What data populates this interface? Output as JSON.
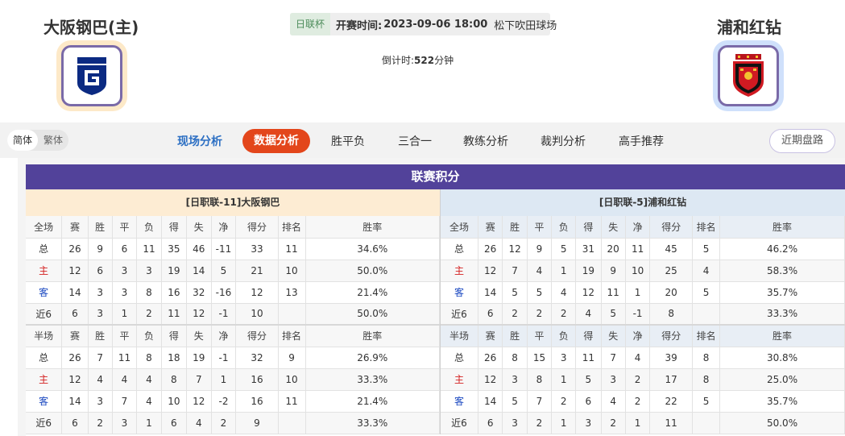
{
  "match": {
    "home_team": "大阪钢巴(主)",
    "away_team": "浦和红钻",
    "league_tag": "日联杯",
    "kickoff_label": "开赛时间:",
    "kickoff_time": "2023-09-06 18:00",
    "venue": "松下吹田球场",
    "countdown_label": "倒计时:",
    "countdown_value": "522",
    "countdown_unit": "分钟"
  },
  "lang": {
    "simplified": "简体",
    "traditional": "繁体"
  },
  "nav": {
    "tabs": [
      "现场分析",
      "数据分析",
      "胜平负",
      "三合一",
      "教练分析",
      "裁判分析",
      "高手推荐"
    ],
    "active_tab": "数据分析",
    "recent_button": "近期盘路"
  },
  "colors": {
    "accent": "#e3461b",
    "section": "#52429a",
    "link": "#2c6fc3",
    "home_row": "#d42020",
    "away_row": "#1a48c0"
  },
  "standings": {
    "title": "联赛积分",
    "home": {
      "label": "[日职联-11]大阪钢巴",
      "full_header": [
        "全场",
        "赛",
        "胜",
        "平",
        "负",
        "得",
        "失",
        "净",
        "得分",
        "排名",
        "胜率"
      ],
      "full_rows": [
        {
          "type": "总",
          "cells": [
            "26",
            "9",
            "6",
            "11",
            "35",
            "46",
            "-11",
            "33",
            "11",
            "34.6%"
          ]
        },
        {
          "type": "主",
          "cells": [
            "12",
            "6",
            "3",
            "3",
            "19",
            "14",
            "5",
            "21",
            "10",
            "50.0%"
          ]
        },
        {
          "type": "客",
          "cells": [
            "14",
            "3",
            "3",
            "8",
            "16",
            "32",
            "-16",
            "12",
            "13",
            "21.4%"
          ]
        },
        {
          "type": "近6",
          "cells": [
            "6",
            "3",
            "1",
            "2",
            "11",
            "12",
            "-1",
            "10",
            "",
            "50.0%"
          ]
        }
      ],
      "half_header": [
        "半场",
        "赛",
        "胜",
        "平",
        "负",
        "得",
        "失",
        "净",
        "得分",
        "排名",
        "胜率"
      ],
      "half_rows": [
        {
          "type": "总",
          "cells": [
            "26",
            "7",
            "11",
            "8",
            "18",
            "19",
            "-1",
            "32",
            "9",
            "26.9%"
          ]
        },
        {
          "type": "主",
          "cells": [
            "12",
            "4",
            "4",
            "4",
            "8",
            "7",
            "1",
            "16",
            "10",
            "33.3%"
          ]
        },
        {
          "type": "客",
          "cells": [
            "14",
            "3",
            "7",
            "4",
            "10",
            "12",
            "-2",
            "16",
            "11",
            "21.4%"
          ]
        },
        {
          "type": "近6",
          "cells": [
            "6",
            "2",
            "3",
            "1",
            "6",
            "4",
            "2",
            "9",
            "",
            "33.3%"
          ]
        }
      ]
    },
    "away": {
      "label": "[日职联-5]浦和红钻",
      "full_header": [
        "全场",
        "赛",
        "胜",
        "平",
        "负",
        "得",
        "失",
        "净",
        "得分",
        "排名",
        "胜率"
      ],
      "full_rows": [
        {
          "type": "总",
          "cells": [
            "26",
            "12",
            "9",
            "5",
            "31",
            "20",
            "11",
            "45",
            "5",
            "46.2%"
          ]
        },
        {
          "type": "主",
          "cells": [
            "12",
            "7",
            "4",
            "1",
            "19",
            "9",
            "10",
            "25",
            "4",
            "58.3%"
          ]
        },
        {
          "type": "客",
          "cells": [
            "14",
            "5",
            "5",
            "4",
            "12",
            "11",
            "1",
            "20",
            "5",
            "35.7%"
          ]
        },
        {
          "type": "近6",
          "cells": [
            "6",
            "2",
            "2",
            "2",
            "4",
            "5",
            "-1",
            "8",
            "",
            "33.3%"
          ]
        }
      ],
      "half_header": [
        "半场",
        "赛",
        "胜",
        "平",
        "负",
        "得",
        "失",
        "净",
        "得分",
        "排名",
        "胜率"
      ],
      "half_rows": [
        {
          "type": "总",
          "cells": [
            "26",
            "8",
            "15",
            "3",
            "11",
            "7",
            "4",
            "39",
            "8",
            "30.8%"
          ]
        },
        {
          "type": "主",
          "cells": [
            "12",
            "3",
            "8",
            "1",
            "5",
            "3",
            "2",
            "17",
            "8",
            "25.0%"
          ]
        },
        {
          "type": "客",
          "cells": [
            "14",
            "5",
            "7",
            "2",
            "6",
            "4",
            "2",
            "22",
            "5",
            "35.7%"
          ]
        },
        {
          "type": "近6",
          "cells": [
            "6",
            "3",
            "2",
            "1",
            "3",
            "2",
            "1",
            "11",
            "",
            "50.0%"
          ]
        }
      ]
    }
  }
}
